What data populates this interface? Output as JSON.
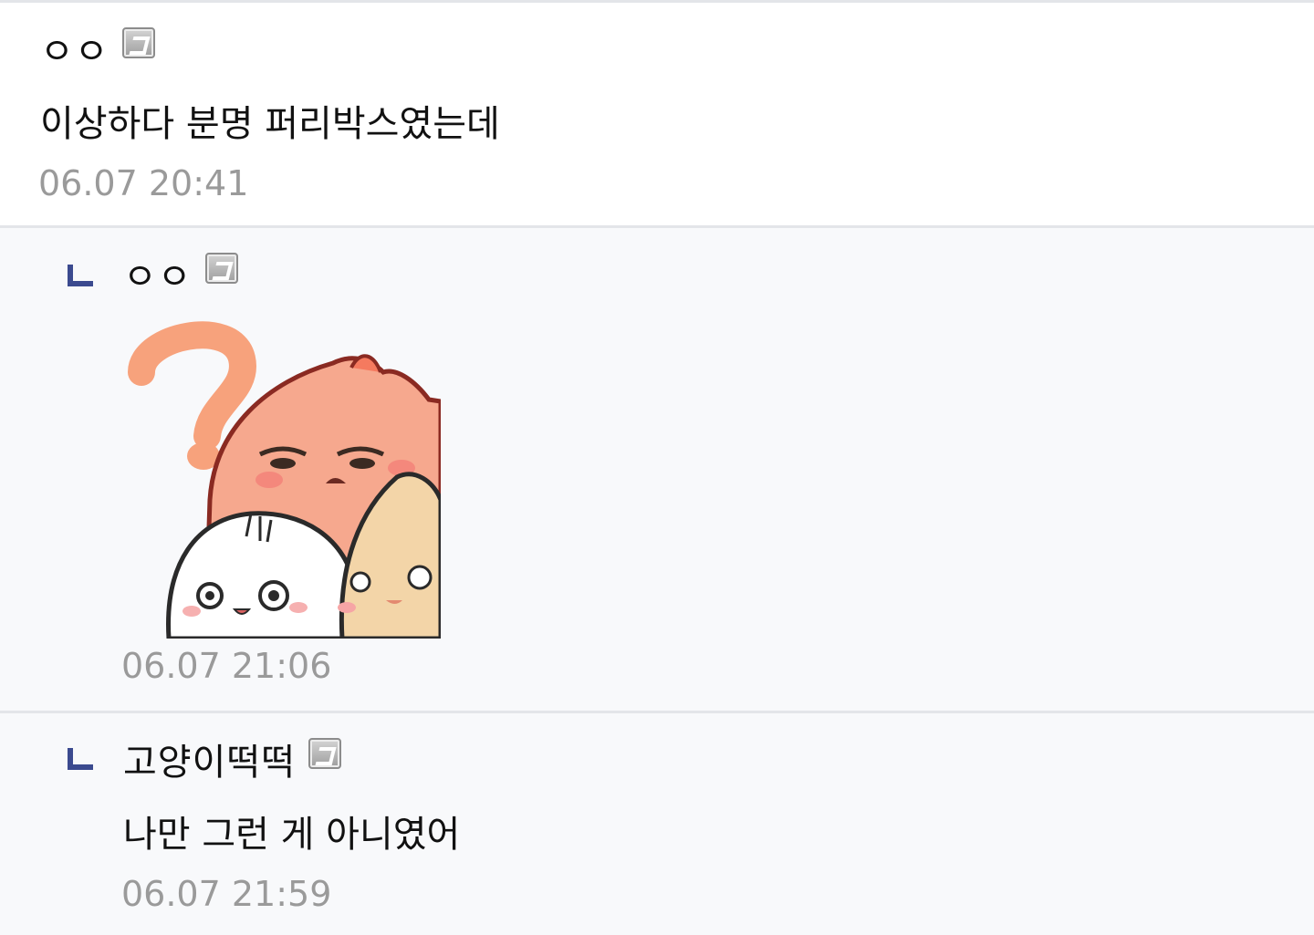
{
  "comments": [
    {
      "nickname": "ㅇㅇ",
      "text": "이상하다 분명 퍼리박스였는데",
      "time": "06.07 20:41"
    },
    {
      "nickname": "ㅇㅇ",
      "sticker": "dumpling-characters-question-sticker",
      "time": "06.07 21:06"
    },
    {
      "nickname": "고양이떡떡",
      "text": "나만 그런 게 아니였어",
      "time": "06.07 21:59"
    }
  ],
  "icons": {
    "badge": "fixed-nick-badge-icon",
    "reply": "reply-arrow-icon"
  },
  "colors": {
    "reply_arrow": "#3b4a8f",
    "timestamp": "#9a9a9a",
    "divider": "#e3e5e9",
    "reply_background": "#f8f9fb"
  }
}
